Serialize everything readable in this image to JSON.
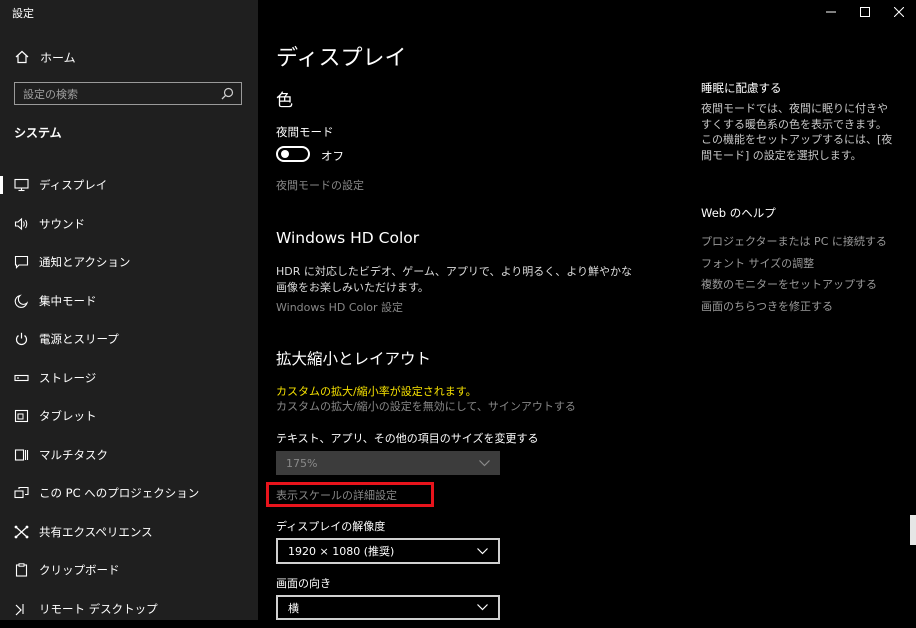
{
  "window": {
    "title": "設定"
  },
  "sidebar": {
    "home_label": "ホーム",
    "search_placeholder": "設定の検索",
    "section": "システム",
    "items": [
      {
        "label": "ディスプレイ",
        "icon": "monitor-icon",
        "selected": true
      },
      {
        "label": "サウンド",
        "icon": "speaker-icon"
      },
      {
        "label": "通知とアクション",
        "icon": "notification-icon"
      },
      {
        "label": "集中モード",
        "icon": "moon-icon"
      },
      {
        "label": "電源とスリープ",
        "icon": "power-icon"
      },
      {
        "label": "ストレージ",
        "icon": "storage-icon"
      },
      {
        "label": "タブレット",
        "icon": "tablet-icon"
      },
      {
        "label": "マルチタスク",
        "icon": "multitask-icon"
      },
      {
        "label": "この PC へのプロジェクション",
        "icon": "projection-icon"
      },
      {
        "label": "共有エクスペリエンス",
        "icon": "share-icon"
      },
      {
        "label": "クリップボード",
        "icon": "clipboard-icon"
      },
      {
        "label": "リモート デスクトップ",
        "icon": "remote-desktop-icon"
      }
    ]
  },
  "main": {
    "title": "ディスプレイ",
    "color": {
      "heading": "色",
      "night_mode_label": "夜間モード",
      "night_mode_state": "オフ",
      "night_mode_settings_link": "夜間モードの設定"
    },
    "hdr": {
      "heading": "Windows HD Color",
      "description": "HDR に対応したビデオ、ゲーム、アプリで、より明るく、より鮮やかな画像をお楽しみいただけます。",
      "link": "Windows HD Color 設定"
    },
    "scale": {
      "heading": "拡大縮小とレイアウト",
      "warning": "カスタムの拡大/縮小率が設定されます。",
      "signout_link": "カスタムの拡大/縮小の設定を無効にして、サインアウトする",
      "size_label": "テキスト、アプリ、その他の項目のサイズを変更する",
      "size_value": "175%",
      "advanced_link": "表示スケールの詳細設定",
      "resolution_label": "ディスプレイの解像度",
      "resolution_value": "1920 × 1080 (推奨)",
      "orientation_label": "画面の向き",
      "orientation_value": "横"
    }
  },
  "right_panel": {
    "sleep_heading": "睡眠に配慮する",
    "sleep_text": "夜間モードでは、夜間に眠りに付きやすくする暖色系の色を表示できます。この機能をセットアップするには、[夜間モード] の設定を選択します。",
    "help_heading": "Web のヘルプ",
    "help_links": [
      "プロジェクターまたは PC に接続する",
      "フォント サイズの調整",
      "複数のモニターをセットアップする",
      "画面のちらつきを修正する"
    ]
  },
  "colors": {
    "sidebar_bg": "#1f1f1f",
    "main_bg": "#000000",
    "warning": "#f5e000",
    "highlight_box": "#e8141c"
  }
}
